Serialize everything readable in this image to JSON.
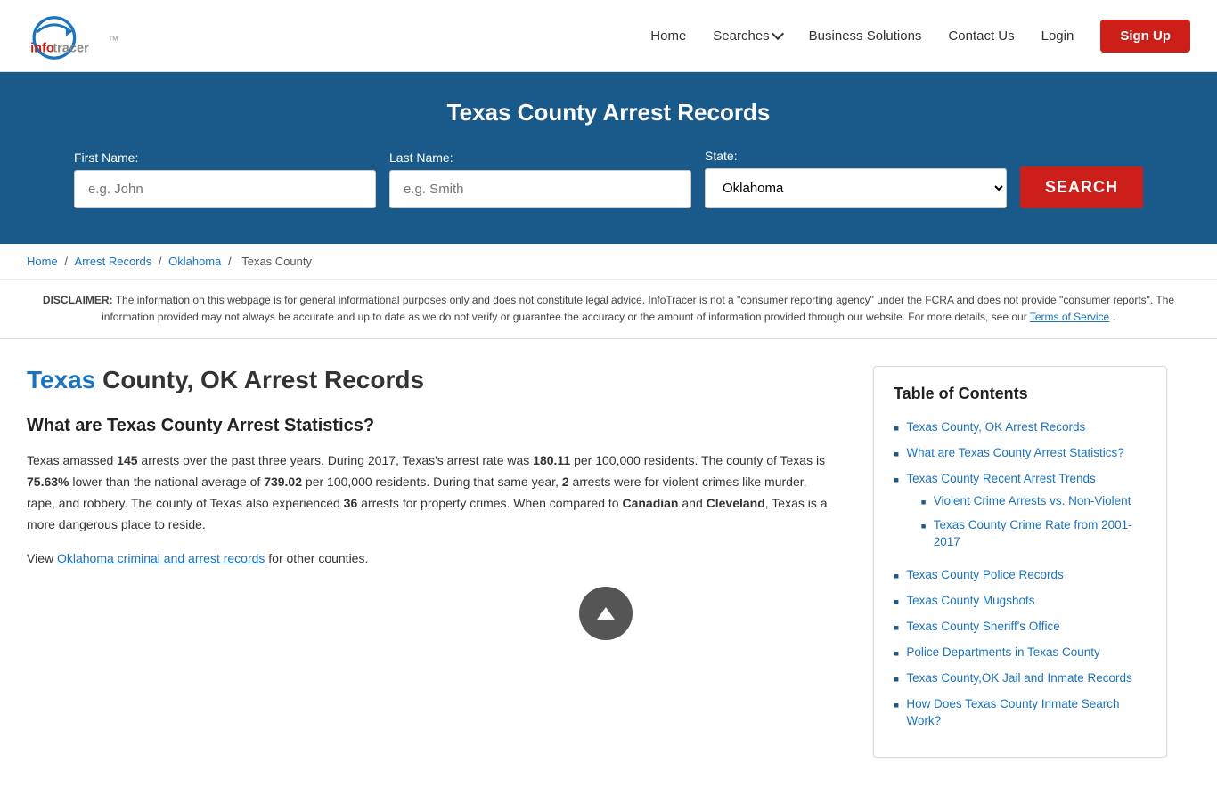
{
  "header": {
    "logo_alt": "InfoTracer",
    "nav": {
      "home": "Home",
      "searches": "Searches",
      "business_solutions": "Business Solutions",
      "contact_us": "Contact Us",
      "login": "Login",
      "signup": "Sign Up"
    }
  },
  "hero": {
    "title": "Texas County Arrest Records",
    "form": {
      "first_name_label": "First Name:",
      "first_name_placeholder": "e.g. John",
      "last_name_label": "Last Name:",
      "last_name_placeholder": "e.g. Smith",
      "state_label": "State:",
      "state_value": "Oklahoma",
      "search_button": "SEARCH"
    }
  },
  "breadcrumb": {
    "home": "Home",
    "arrest_records": "Arrest Records",
    "oklahoma": "Oklahoma",
    "texas_county": "Texas County"
  },
  "disclaimer": {
    "text_bold": "DISCLAIMER:",
    "text": " The information on this webpage is for general informational purposes only and does not constitute legal advice. InfoTracer is not a \"consumer reporting agency\" under the FCRA and does not provide \"consumer reports\". The information provided may not always be accurate and up to date as we do not verify or guarantee the accuracy or the amount of information provided through our website. For more details, see our ",
    "tos_link": "Terms of Service",
    "tos_end": "."
  },
  "article": {
    "title_highlight": "Texas",
    "title_rest": " County, OK Arrest Records",
    "section1_heading": "What are Texas County Arrest Statistics?",
    "paragraph1_pre": "Texas amassed ",
    "paragraph1_num1": "145",
    "paragraph1_mid1": " arrests over the past three years. During 2017, Texas's arrest rate was ",
    "paragraph1_num2": "180.11",
    "paragraph1_mid2": " per 100,000 residents. The county of Texas is ",
    "paragraph1_pct": "75.63%",
    "paragraph1_mid3": " lower than the national average of ",
    "paragraph1_num3": "739.02",
    "paragraph1_mid4": " per 100,000 residents. During that same year, ",
    "paragraph1_num4": "2",
    "paragraph1_mid5": " arrests were for violent crimes like murder, rape, and robbery. The county of Texas also experienced ",
    "paragraph1_num5": "36",
    "paragraph1_mid6": " arrests for property crimes. When compared to ",
    "paragraph1_bold1": "Canadian",
    "paragraph1_and": " and ",
    "paragraph1_bold2": "Cleveland",
    "paragraph1_end": ", Texas is a more dangerous place to reside.",
    "view_pre": "View ",
    "view_link_text": "Oklahoma criminal and arrest records",
    "view_post": " for other counties.",
    "scroll_top_label": "Back to top"
  },
  "toc": {
    "heading": "Table of Contents",
    "items": [
      {
        "text": "Texas County, OK Arrest Records",
        "sub": []
      },
      {
        "text": "What are Texas County Arrest Statistics?",
        "sub": []
      },
      {
        "text": "Texas County Recent Arrest Trends",
        "sub": [
          {
            "text": "Violent Crime Arrests vs. Non-Violent"
          },
          {
            "text": "Texas County Crime Rate from 2001-2017"
          }
        ]
      },
      {
        "text": "Texas County Police Records",
        "sub": []
      },
      {
        "text": "Texas County Mugshots",
        "sub": []
      },
      {
        "text": "Texas County Sheriff's Office",
        "sub": []
      },
      {
        "text": "Police Departments in Texas County",
        "sub": []
      },
      {
        "text": "Texas County,OK Jail and Inmate Records",
        "sub": []
      },
      {
        "text": "How Does Texas County Inmate Search Work?",
        "sub": []
      }
    ]
  }
}
